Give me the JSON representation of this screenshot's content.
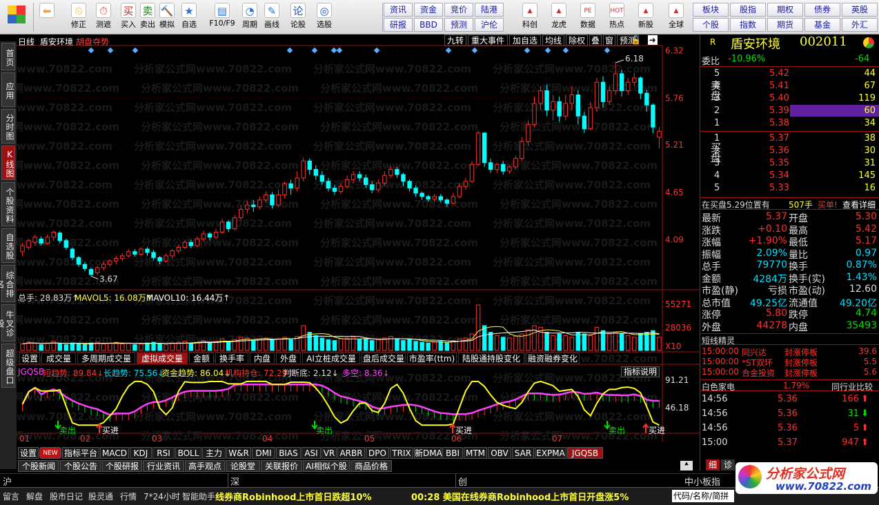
{
  "toolbar": {
    "left": [
      {
        "name": "back-button",
        "label": "",
        "icon": "back-arrow-icon"
      },
      {
        "name": "restore-button",
        "label": "修正",
        "icon": "clock-icon"
      },
      {
        "name": "test-button",
        "label": "测遮",
        "icon": "timer-icon"
      },
      {
        "name": "buy-button",
        "label": "买入",
        "icon": "buy-icon",
        "glyph": "买"
      },
      {
        "name": "sell-button",
        "label": "卖出",
        "icon": "sell-icon",
        "glyph": "卖"
      },
      {
        "name": "simulate-button",
        "label": "模拟",
        "icon": "hammer-icon"
      },
      {
        "name": "self-select-button",
        "label": "自选",
        "icon": "star-icon"
      },
      {
        "name": "f10-button",
        "label": "F10/F9",
        "icon": "document-icon"
      },
      {
        "name": "period-button",
        "label": "周期",
        "icon": "period-icon"
      },
      {
        "name": "draw-button",
        "label": "画线",
        "icon": "pencil-icon"
      },
      {
        "name": "stock-review-button",
        "label": "论股",
        "icon": "discuss-icon",
        "glyph": "论"
      },
      {
        "name": "stock-select-button",
        "label": "选股",
        "icon": "magnify-icon"
      }
    ],
    "grid": [
      [
        "资讯",
        "资金",
        "竞价",
        "陆港"
      ],
      [
        "研报",
        "BBD",
        "预测",
        "沪伦"
      ]
    ],
    "mid": [
      {
        "name": "science-button",
        "label": "科创",
        "icon": "chart-icon"
      },
      {
        "name": "dragon-button",
        "label": "龙虎",
        "icon": "dragon-icon"
      },
      {
        "name": "data-button",
        "label": "数据",
        "icon": "pe-icon",
        "glyph": "PE"
      },
      {
        "name": "hotspot-button",
        "label": "热点",
        "icon": "hot-icon",
        "glyph": "HOT"
      },
      {
        "name": "newstock-button",
        "label": "新股",
        "icon": "newstock-icon"
      },
      {
        "name": "global-button",
        "label": "全球",
        "icon": "globe-icon"
      }
    ],
    "grid2": [
      [
        "板块",
        "股指",
        "期权",
        "债券",
        "英股"
      ],
      [
        "个股",
        "指数",
        "期货",
        "基金",
        "外汇"
      ]
    ]
  },
  "lefttabs": [
    "首页",
    "应用",
    "分时图",
    "K线图",
    "个股资料",
    "自选股",
    "综合排名",
    "牛叉诊股",
    "超级盘口"
  ],
  "header": {
    "period": "日线",
    "stock_name": "盾安环境",
    "feature": "胡盘夺势",
    "buttons": [
      "九转",
      "重大事件",
      "加自选",
      "均线",
      "除权",
      "叠",
      "窗",
      "预测"
    ]
  },
  "price_axis": [
    "6.32",
    "5.76",
    "5.21",
    "4.65",
    "4.09"
  ],
  "annotations": {
    "high": "6.18",
    "low": "3.67"
  },
  "volume": {
    "total": "总手: 28.83万↑",
    "mavol5": "MAVOL5: 16.08万↑",
    "mavol10": "MAVOL10: 16.44万↑",
    "axis": [
      "55271",
      "28036",
      "X10"
    ]
  },
  "indicator_tabs": [
    "设置",
    "成交量",
    "多周期成交量",
    "虚拟成交量",
    "金额",
    "换手率",
    "内盘",
    "外盘",
    "AI立桩成交量",
    "盘后成交量",
    "市盈率(ttm)",
    "陆股通持股变化",
    "融资融券变化"
  ],
  "jgqsb": {
    "label": "JGQSB",
    "short": "短趋势: 89.84↓",
    "long": "长趋势: 75.56↓",
    "fund": "资金趋势: 86.04↓",
    "inst": "机构持仓: 72.29↑",
    "judge": "判断底: 2.12↓",
    "bull": "多空: 8.36↓",
    "help": "指标说明",
    "axis": [
      "91.21",
      "46.18"
    ],
    "signals": [
      {
        "t": "卖出"
      },
      {
        "t": "买进"
      },
      {
        "t": "卖出"
      },
      {
        "t": "买进"
      },
      {
        "t": "卖出"
      },
      {
        "t": "买进"
      }
    ]
  },
  "months": [
    "01",
    "02",
    "03",
    "04",
    "05",
    "06",
    "07"
  ],
  "bottom_tabs": [
    "设置",
    "NEW",
    "指标平台",
    "MACD",
    "KDJ",
    "RSI",
    "BOLL",
    "主力",
    "W&R",
    "DMI",
    "BIAS",
    "ASI",
    "VR",
    "ARBR",
    "DPO",
    "TRIX",
    "新DMA",
    "BBI",
    "MTM",
    "OBV",
    "SAR",
    "EXPMA",
    "JGQSB"
  ],
  "news_tabs": [
    "个股新闻",
    "个股公告",
    "个股研报",
    "行业资讯",
    "高手观点",
    "论股堂",
    "关联报价",
    "AI相似个股",
    "商品价格"
  ],
  "market_row": {
    "sh": "沪",
    "sz": "深",
    "cy": "创",
    "zxb": "中小板指"
  },
  "status": {
    "items": [
      "留言",
      "解盘",
      "股市日记",
      "股灵通",
      "行情",
      "7*24小时",
      "智能助手"
    ],
    "ticker1": "线券商Robinhood上市首日跌超10%",
    "ticker2": "00:28 美国在线券商Robinhood上市首日开盘涨5%",
    "code_input": "代码/名称/简拼"
  },
  "watermark": "分析家公式网www.70822.com",
  "logo": {
    "text": "分析家公式网",
    "url": "www.70822.com"
  },
  "quote": {
    "name": "盾安环境",
    "code": "002011",
    "r": "R",
    "weibi_label": "委比",
    "weibi": "-10.96%",
    "weicha": "-64",
    "sell_label": "卖盘",
    "buy_label": "买盘",
    "asks": [
      {
        "n": "5",
        "p": "5.42",
        "v": "44"
      },
      {
        "n": "4",
        "p": "5.41",
        "v": "67"
      },
      {
        "n": "3",
        "p": "5.40",
        "v": "119"
      },
      {
        "n": "2",
        "p": "5.39",
        "v": "60"
      },
      {
        "n": "1",
        "p": "5.38",
        "v": "34"
      }
    ],
    "bids": [
      {
        "n": "1",
        "p": "5.37",
        "v": "38"
      },
      {
        "n": "2",
        "p": "5.36",
        "v": "30"
      },
      {
        "n": "3",
        "p": "5.35",
        "v": "31"
      },
      {
        "n": "4",
        "p": "5.34",
        "v": "145"
      },
      {
        "n": "5",
        "p": "5.33",
        "v": "16"
      }
    ],
    "inbuy": "在买盘5.29位置有",
    "inbuy_vol": "507手",
    "inbuy_act": "买单!",
    "detail": "查看详细",
    "stats": [
      {
        "l1": "最新",
        "v1": "5.37",
        "c1": "#ff3030",
        "l2": "开盘",
        "v2": "5.30",
        "c2": "#ff3030"
      },
      {
        "l1": "涨跌",
        "v1": "+0.10",
        "c1": "#ff3030",
        "l2": "最高",
        "v2": "5.42",
        "c2": "#ff3030"
      },
      {
        "l1": "涨幅",
        "v1": "+1.90%",
        "c1": "#ff3030",
        "l2": "最低",
        "v2": "5.17",
        "c2": "#ff3030"
      },
      {
        "l1": "振幅",
        "v1": "2.09%",
        "c1": "#00e0ff",
        "l2": "量比",
        "v2": "0.97",
        "c2": "#00e0ff"
      },
      {
        "l1": "总手",
        "v1": "79770",
        "c1": "#00e0ff",
        "l2": "换手",
        "v2": "0.87%",
        "c2": "#00e0ff"
      },
      {
        "l1": "金额",
        "v1": "4284万",
        "c1": "#00e0ff",
        "l2": "换手(实)",
        "v2": "1.43%",
        "c2": "#00e0ff"
      },
      {
        "l1": "市盈(静)",
        "v1": "亏损",
        "c1": "#ddd",
        "l2": "市盈(动)",
        "v2": "12.60",
        "c2": "#ddd"
      },
      {
        "l1": "总市值",
        "v1": "49.25亿",
        "c1": "#00e0ff",
        "l2": "流通值",
        "v2": "49.20亿",
        "c2": "#00e0ff"
      },
      {
        "l1": "涨停",
        "v1": "5.80",
        "c1": "#ff3030",
        "l2": "跌停",
        "v2": "4.74",
        "c2": "#00e000"
      },
      {
        "l1": "外盘",
        "v1": "44278",
        "c1": "#ff3030",
        "l2": "内盘",
        "v2": "35493",
        "c2": "#00e000"
      }
    ],
    "spirit_title": "短线精灵",
    "spirit": [
      {
        "t": "15:00:00",
        "n": "同兴达",
        "a": "封涨停板",
        "v": "39.6"
      },
      {
        "t": "15:00:00",
        "n": "*ST双环",
        "a": "封涨停板",
        "v": "5.5"
      },
      {
        "t": "15:00:00",
        "n": "合金投资",
        "a": "封涨停板",
        "v": "5.6"
      }
    ],
    "industry": "白色家电",
    "industry_pct": "1.79%",
    "industry_cmp": "同行业比较",
    "ticks": [
      {
        "t": "14:56",
        "p": "5.36",
        "v": "166",
        "d": "up"
      },
      {
        "t": "14:56",
        "p": "5.36",
        "v": "31",
        "d": "down"
      },
      {
        "t": "14:56",
        "p": "5.36",
        "v": "5",
        "d": "up"
      },
      {
        "t": "15:00",
        "p": "5.37",
        "v": "947",
        "d": "up"
      }
    ],
    "tabs": [
      "细",
      "诊"
    ]
  },
  "chart_data": {
    "type": "candlestick",
    "ylim": [
      3.5,
      6.35
    ],
    "candles": [
      [
        3.95,
        4.02,
        3.9,
        4.05
      ],
      [
        4.0,
        4.08,
        3.97,
        4.1
      ],
      [
        4.06,
        4.12,
        4.03,
        4.15
      ],
      [
        4.1,
        4.05,
        4.02,
        4.13
      ],
      [
        4.05,
        4.12,
        4.03,
        4.15
      ],
      [
        4.12,
        4.18,
        4.08,
        4.2
      ],
      [
        4.17,
        4.08,
        4.05,
        4.19
      ],
      [
        4.08,
        4.0,
        3.97,
        4.1
      ],
      [
        3.98,
        3.88,
        3.85,
        4.0
      ],
      [
        3.88,
        3.8,
        3.77,
        3.9
      ],
      [
        3.8,
        3.75,
        3.72,
        3.83
      ],
      [
        3.74,
        3.68,
        3.66,
        3.76
      ],
      [
        3.7,
        3.76,
        3.67,
        3.78
      ],
      [
        3.76,
        3.8,
        3.73,
        3.83
      ],
      [
        3.8,
        3.84,
        3.77,
        3.86
      ],
      [
        3.84,
        3.87,
        3.8,
        3.9
      ],
      [
        3.87,
        3.9,
        3.84,
        3.93
      ],
      [
        3.9,
        3.95,
        3.88,
        3.98
      ],
      [
        3.95,
        3.92,
        3.89,
        3.98
      ],
      [
        3.92,
        3.98,
        3.9,
        4.0
      ],
      [
        3.98,
        3.94,
        3.9,
        4.0
      ],
      [
        3.94,
        3.88,
        3.85,
        3.97
      ],
      [
        3.88,
        3.84,
        3.8,
        3.9
      ],
      [
        3.84,
        3.9,
        3.82,
        3.93
      ],
      [
        3.9,
        3.96,
        3.87,
        3.98
      ],
      [
        3.96,
        4.0,
        3.93,
        4.03
      ],
      [
        4.0,
        4.06,
        3.98,
        4.08
      ],
      [
        4.06,
        4.02,
        3.99,
        4.09
      ],
      [
        4.02,
        4.1,
        4.0,
        4.13
      ],
      [
        4.1,
        4.16,
        4.07,
        4.2
      ],
      [
        4.16,
        4.12,
        4.08,
        4.18
      ],
      [
        4.12,
        4.18,
        4.1,
        4.22
      ],
      [
        4.18,
        4.3,
        4.16,
        4.34
      ],
      [
        4.3,
        4.22,
        4.18,
        4.32
      ],
      [
        4.22,
        4.35,
        4.2,
        4.38
      ],
      [
        4.35,
        4.45,
        4.32,
        4.5
      ],
      [
        4.45,
        4.5,
        4.4,
        4.55
      ],
      [
        4.5,
        4.48,
        4.42,
        4.56
      ],
      [
        4.48,
        4.56,
        4.45,
        4.6
      ],
      [
        4.56,
        4.62,
        4.52,
        4.66
      ],
      [
        4.62,
        4.5,
        4.46,
        4.65
      ],
      [
        4.5,
        4.62,
        4.48,
        4.68
      ],
      [
        4.62,
        4.75,
        4.58,
        4.78
      ],
      [
        4.75,
        4.7,
        4.62,
        4.8
      ],
      [
        4.7,
        4.82,
        4.66,
        4.9
      ],
      [
        4.82,
        5.02,
        4.78,
        5.06
      ],
      [
        5.02,
        4.92,
        4.86,
        5.05
      ],
      [
        4.92,
        4.85,
        4.8,
        4.97
      ],
      [
        4.85,
        4.78,
        4.74,
        4.9
      ],
      [
        4.78,
        4.7,
        4.66,
        4.82
      ],
      [
        4.7,
        4.66,
        4.62,
        4.74
      ],
      [
        4.66,
        4.72,
        4.63,
        4.76
      ],
      [
        4.72,
        4.8,
        4.7,
        4.85
      ],
      [
        4.8,
        4.86,
        4.76,
        4.9
      ],
      [
        4.86,
        4.82,
        4.78,
        4.9
      ],
      [
        4.82,
        4.74,
        4.7,
        4.86
      ],
      [
        4.74,
        4.68,
        4.64,
        4.78
      ],
      [
        4.68,
        4.76,
        4.65,
        4.8
      ],
      [
        4.76,
        4.85,
        4.72,
        4.9
      ],
      [
        4.85,
        4.92,
        4.82,
        4.96
      ],
      [
        4.92,
        4.86,
        4.82,
        4.95
      ],
      [
        4.86,
        4.78,
        4.72,
        4.88
      ],
      [
        4.78,
        4.7,
        4.66,
        4.8
      ],
      [
        4.7,
        4.64,
        4.6,
        4.73
      ],
      [
        4.64,
        4.6,
        4.56,
        4.66
      ],
      [
        4.6,
        4.57,
        4.54,
        4.62
      ],
      [
        4.57,
        4.6,
        4.54,
        4.63
      ],
      [
        4.6,
        4.56,
        4.53,
        4.63
      ],
      [
        4.56,
        4.52,
        4.48,
        4.58
      ],
      [
        4.52,
        4.6,
        4.5,
        4.64
      ],
      [
        4.6,
        4.72,
        4.58,
        4.76
      ],
      [
        4.72,
        4.78,
        4.68,
        4.82
      ],
      [
        4.78,
        4.98,
        4.76,
        5.02
      ],
      [
        4.98,
        5.35,
        4.96,
        5.38
      ],
      [
        5.35,
        5.0,
        4.95,
        5.36
      ],
      [
        5.0,
        4.92,
        4.88,
        5.05
      ],
      [
        4.92,
        4.98,
        4.88,
        5.0
      ],
      [
        4.98,
        4.9,
        4.86,
        5.02
      ],
      [
        4.9,
        4.95,
        4.87,
        4.98
      ],
      [
        4.95,
        5.05,
        4.92,
        5.08
      ],
      [
        5.05,
        5.25,
        5.02,
        5.3
      ],
      [
        5.25,
        5.45,
        5.2,
        5.5
      ],
      [
        5.45,
        5.7,
        5.42,
        5.78
      ],
      [
        5.7,
        5.85,
        5.62,
        5.9
      ],
      [
        5.85,
        5.62,
        5.55,
        5.92
      ],
      [
        5.62,
        5.72,
        5.5,
        5.8
      ],
      [
        5.72,
        5.55,
        5.48,
        5.78
      ],
      [
        5.55,
        5.7,
        5.5,
        5.8
      ],
      [
        5.7,
        5.8,
        5.62,
        5.9
      ],
      [
        5.8,
        5.55,
        5.45,
        5.85
      ],
      [
        5.55,
        5.4,
        5.35,
        5.6
      ],
      [
        5.4,
        5.65,
        5.38,
        5.72
      ],
      [
        5.65,
        5.95,
        5.6,
        6.0
      ],
      [
        5.95,
        5.72,
        5.65,
        6.02
      ],
      [
        5.72,
        5.85,
        5.68,
        5.9
      ],
      [
        5.85,
        6.05,
        5.8,
        6.18
      ],
      [
        6.05,
        5.85,
        5.78,
        6.1
      ],
      [
        5.85,
        5.95,
        5.8,
        6.0
      ],
      [
        5.95,
        6.0,
        5.9,
        6.06
      ],
      [
        6.0,
        5.82,
        5.75,
        6.02
      ],
      [
        5.82,
        5.68,
        5.6,
        5.86
      ],
      [
        5.68,
        5.42,
        5.35,
        5.7
      ],
      [
        5.3,
        5.37,
        5.17,
        5.42
      ]
    ],
    "volumes": [
      8,
      10,
      9,
      7,
      9,
      11,
      8,
      7,
      9,
      8,
      7,
      9,
      10,
      8,
      9,
      10,
      8,
      9,
      7,
      8,
      9,
      10,
      8,
      7,
      9,
      10,
      11,
      9,
      10,
      12,
      9,
      11,
      14,
      10,
      13,
      16,
      15,
      12,
      14,
      15,
      13,
      14,
      16,
      13,
      17,
      30,
      22,
      18,
      15,
      13,
      12,
      14,
      15,
      16,
      13,
      14,
      12,
      13,
      15,
      17,
      14,
      12,
      13,
      11,
      10,
      9,
      10,
      11,
      9,
      12,
      14,
      15,
      20,
      55,
      30,
      22,
      18,
      16,
      15,
      17,
      20,
      25,
      30,
      28,
      22,
      18,
      20,
      18,
      16,
      22,
      20,
      18,
      28,
      24,
      20,
      22,
      20,
      18,
      16,
      20,
      22,
      24,
      16
    ],
    "months": [
      "01",
      "02",
      "03",
      "04",
      "05",
      "06",
      "07"
    ]
  }
}
